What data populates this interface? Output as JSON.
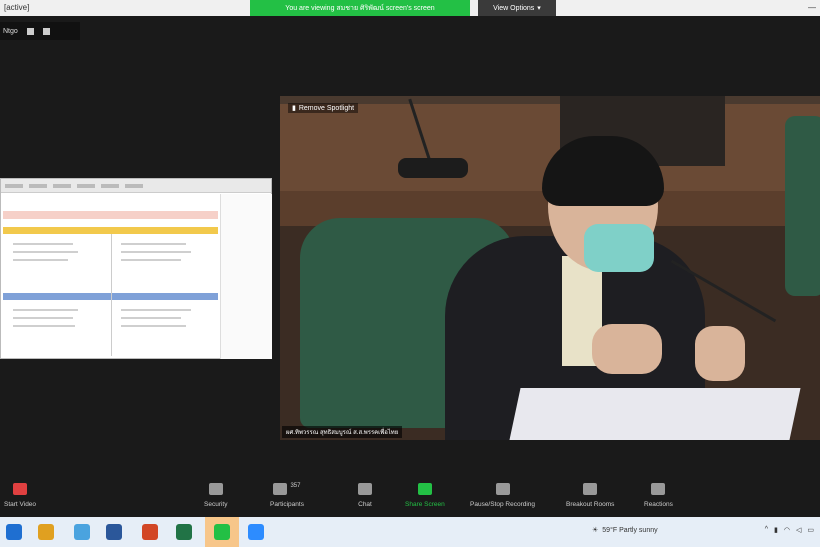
{
  "window": {
    "app_title": "[active]",
    "share_banner": "You are viewing สมชาย ศิริพัฒน์ screen's screen",
    "view_options": "View Options",
    "view_options_chevron": "▾",
    "controls": "—"
  },
  "meeting_chip": {
    "label": "Ntgo"
  },
  "video": {
    "spotlight_label": "Remove Spotlight",
    "name_caption": "ผศ.ทิพวรรณ สุทธิสมบูรณ์ ส.ส.พรรคเพื่อไทย"
  },
  "toolbar": {
    "items": [
      {
        "label": "Start Video",
        "icon": "video-off-icon"
      },
      {
        "label": "Security",
        "icon": "shield-icon"
      },
      {
        "label": "Participants",
        "icon": "participants-icon",
        "count": "357"
      },
      {
        "label": "Chat",
        "icon": "chat-icon"
      },
      {
        "label": "Share Screen",
        "icon": "share-screen-icon"
      },
      {
        "label": "Pause/Stop Recording",
        "icon": "recording-icon"
      },
      {
        "label": "Breakout Rooms",
        "icon": "breakout-icon"
      },
      {
        "label": "Reactions",
        "icon": "reactions-icon"
      }
    ]
  },
  "taskbar": {
    "weather": "59°F Partly sunny",
    "apps": [
      "edge-icon",
      "chrome-icon",
      "explorer-icon",
      "word-icon",
      "powerpoint-icon",
      "excel-icon",
      "line-icon",
      "zoom-icon"
    ]
  },
  "colors": {
    "green": "#23c045",
    "bg": "#1a1a1a"
  }
}
